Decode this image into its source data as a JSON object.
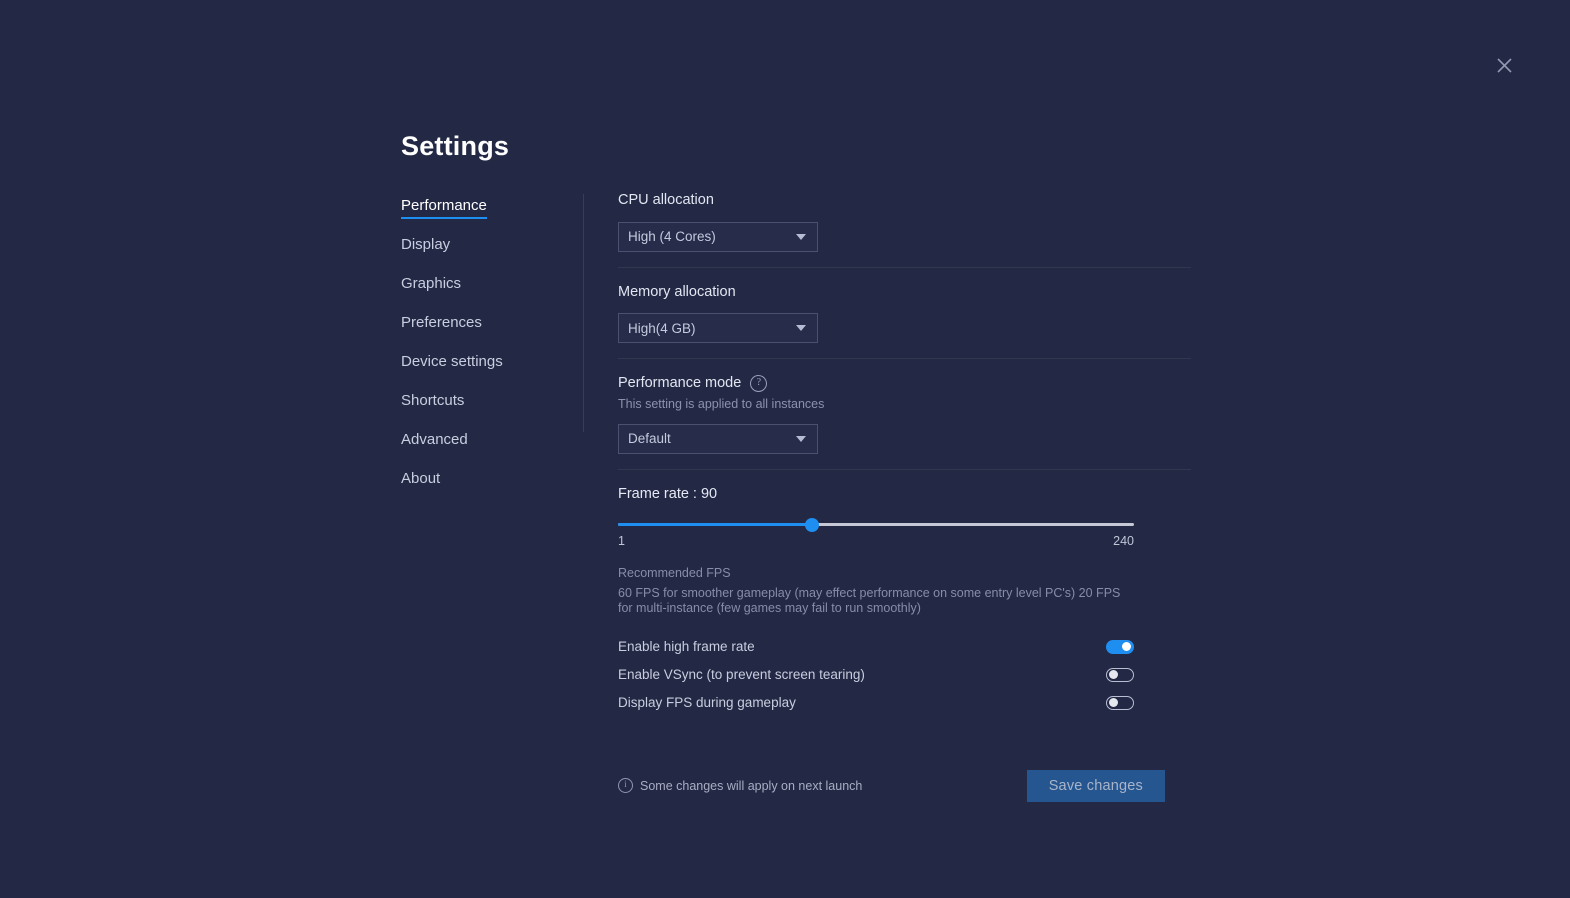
{
  "window": {
    "close_label": "close-icon"
  },
  "header": {
    "title": "Settings"
  },
  "sidebar": {
    "items": [
      {
        "label": "Performance",
        "active": true
      },
      {
        "label": "Display",
        "active": false
      },
      {
        "label": "Graphics",
        "active": false
      },
      {
        "label": "Preferences",
        "active": false
      },
      {
        "label": "Device settings",
        "active": false
      },
      {
        "label": "Shortcuts",
        "active": false
      },
      {
        "label": "Advanced",
        "active": false
      },
      {
        "label": "About",
        "active": false
      }
    ]
  },
  "main": {
    "cpu": {
      "label": "CPU allocation",
      "value": "High (4 Cores)"
    },
    "memory": {
      "label": "Memory allocation",
      "value": "High(4 GB)"
    },
    "performance_mode": {
      "label": "Performance mode",
      "help_icon": "question-mark-icon",
      "description": "This setting is applied to all instances",
      "value": "Default"
    },
    "frame_rate": {
      "label": "Frame rate : 90",
      "value": 90,
      "min_label": "1",
      "max_label": "240",
      "min": 1,
      "max": 240,
      "fill_percent": 37.6,
      "recommended_title": "Recommended FPS",
      "recommended_text": "60 FPS for smoother gameplay (may effect performance on some entry level PC's) 20 FPS for multi-instance (few games may fail to run smoothly)"
    },
    "toggles": [
      {
        "label": "Enable high frame rate",
        "on": true
      },
      {
        "label": "Enable VSync (to prevent screen tearing)",
        "on": false
      },
      {
        "label": "Display FPS during gameplay",
        "on": false
      }
    ]
  },
  "footer": {
    "note": "Some changes will apply on next launch",
    "note_icon": "info-icon",
    "save_label": "Save changes"
  },
  "colors": {
    "background": "#232944",
    "accent": "#1f8ef1",
    "save_button": "#255690",
    "text_primary": "#e2e6f2",
    "text_muted": "#878da8"
  }
}
